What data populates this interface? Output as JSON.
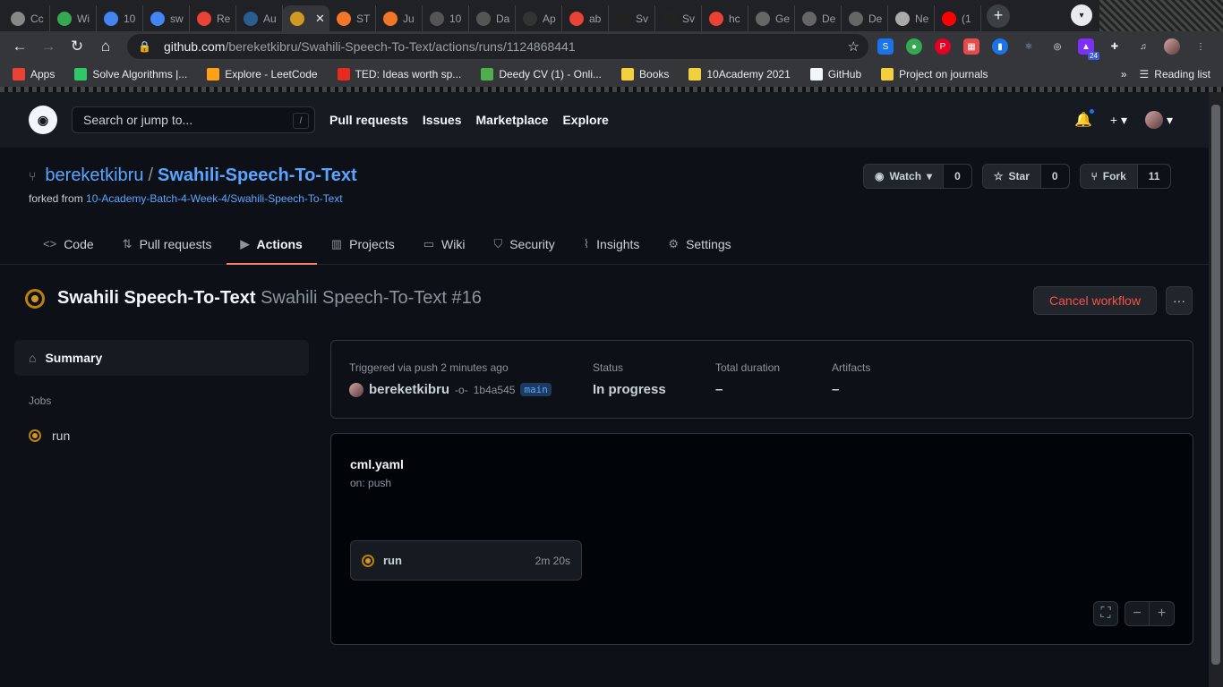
{
  "browser": {
    "tabs": [
      {
        "label": "Cc",
        "fav": "#888"
      },
      {
        "label": "Wi",
        "fav": "#34a853"
      },
      {
        "label": "10",
        "fav": "#4285f4"
      },
      {
        "label": "sw",
        "fav": "#4285f4"
      },
      {
        "label": "Re",
        "fav": "#ea4335"
      },
      {
        "label": "Au",
        "fav": "#2a5d8f"
      },
      {
        "label": "",
        "fav": "#d29922",
        "active": true
      },
      {
        "label": "ST",
        "fav": "#f37626"
      },
      {
        "label": "Ju",
        "fav": "#f37626"
      },
      {
        "label": "10",
        "fav": "#555"
      },
      {
        "label": "Da",
        "fav": "#555"
      },
      {
        "label": "Ap",
        "fav": "#333"
      },
      {
        "label": "ab",
        "fav": "#ea4335"
      },
      {
        "label": "Sv",
        "fav": "#222"
      },
      {
        "label": "Sv",
        "fav": "#222"
      },
      {
        "label": "hc",
        "fav": "#ea4335"
      },
      {
        "label": "Ge",
        "fav": "#666"
      },
      {
        "label": "De",
        "fav": "#666"
      },
      {
        "label": "De",
        "fav": "#666"
      },
      {
        "label": "Ne",
        "fav": "#aaa"
      },
      {
        "label": "(1",
        "fav": "#ff0000"
      }
    ],
    "active_close": "✕",
    "newtab": "+",
    "url_host": "github.com",
    "url_path": "/bereketkibru/Swahili-Speech-To-Text/actions/runs/1124868441",
    "ext_badge": "24",
    "bookmarks": [
      {
        "label": "Apps",
        "color": "#ea4335"
      },
      {
        "label": "Solve Algorithms |...",
        "color": "#2ec866"
      },
      {
        "label": "Explore - LeetCode",
        "color": "#ffa116"
      },
      {
        "label": "TED: Ideas worth sp...",
        "color": "#e62b1e"
      },
      {
        "label": "Deedy CV (1) - Onli...",
        "color": "#4cae4c"
      },
      {
        "label": "Books",
        "color": "#f4d03f"
      },
      {
        "label": "10Academy 2021",
        "color": "#f4d03f"
      },
      {
        "label": "GitHub",
        "color": "#f0f6fc"
      },
      {
        "label": "Project on journals",
        "color": "#f4d03f"
      }
    ],
    "bm_more": "»",
    "reading_list": "Reading list"
  },
  "github": {
    "search_placeholder": "Search or jump to...",
    "search_slash": "/",
    "nav": [
      "Pull requests",
      "Issues",
      "Marketplace",
      "Explore"
    ]
  },
  "repo": {
    "owner": "bereketkibru",
    "sep": "/",
    "name": "Swahili-Speech-To-Text",
    "forked_prefix": "forked from ",
    "forked_from": "10-Academy-Batch-4-Week-4/Swahili-Speech-To-Text",
    "watch_label": "Watch",
    "watch_count": "0",
    "star_label": "Star",
    "star_count": "0",
    "fork_label": "Fork",
    "fork_count": "11",
    "tabs": [
      {
        "label": "Code",
        "icon": "<>"
      },
      {
        "label": "Pull requests",
        "icon": "⇅"
      },
      {
        "label": "Actions",
        "icon": "▶"
      },
      {
        "label": "Projects",
        "icon": "▥"
      },
      {
        "label": "Wiki",
        "icon": "▭"
      },
      {
        "label": "Security",
        "icon": "⛉"
      },
      {
        "label": "Insights",
        "icon": "⌇"
      },
      {
        "label": "Settings",
        "icon": "⚙"
      }
    ]
  },
  "run": {
    "workflow": "Swahili Speech-To-Text",
    "run_name": "Swahili Speech-To-Text #16",
    "cancel": "Cancel workflow",
    "more": "···",
    "summary": "Summary",
    "jobs_heading": "Jobs",
    "job_name": "run",
    "triggered": "Triggered via push 2 minutes ago",
    "actor": "bereketkibru",
    "sha": "1b4a545",
    "branch": "main",
    "status_label": "Status",
    "status_value": "In progress",
    "duration_label": "Total duration",
    "duration_value": "–",
    "artifacts_label": "Artifacts",
    "artifacts_value": "–",
    "workflow_file": "cml.yaml",
    "trigger_event": "on: push",
    "job_duration": "2m 20s",
    "zoom_fit": "⛶",
    "zoom_out": "−",
    "zoom_in": "+"
  }
}
